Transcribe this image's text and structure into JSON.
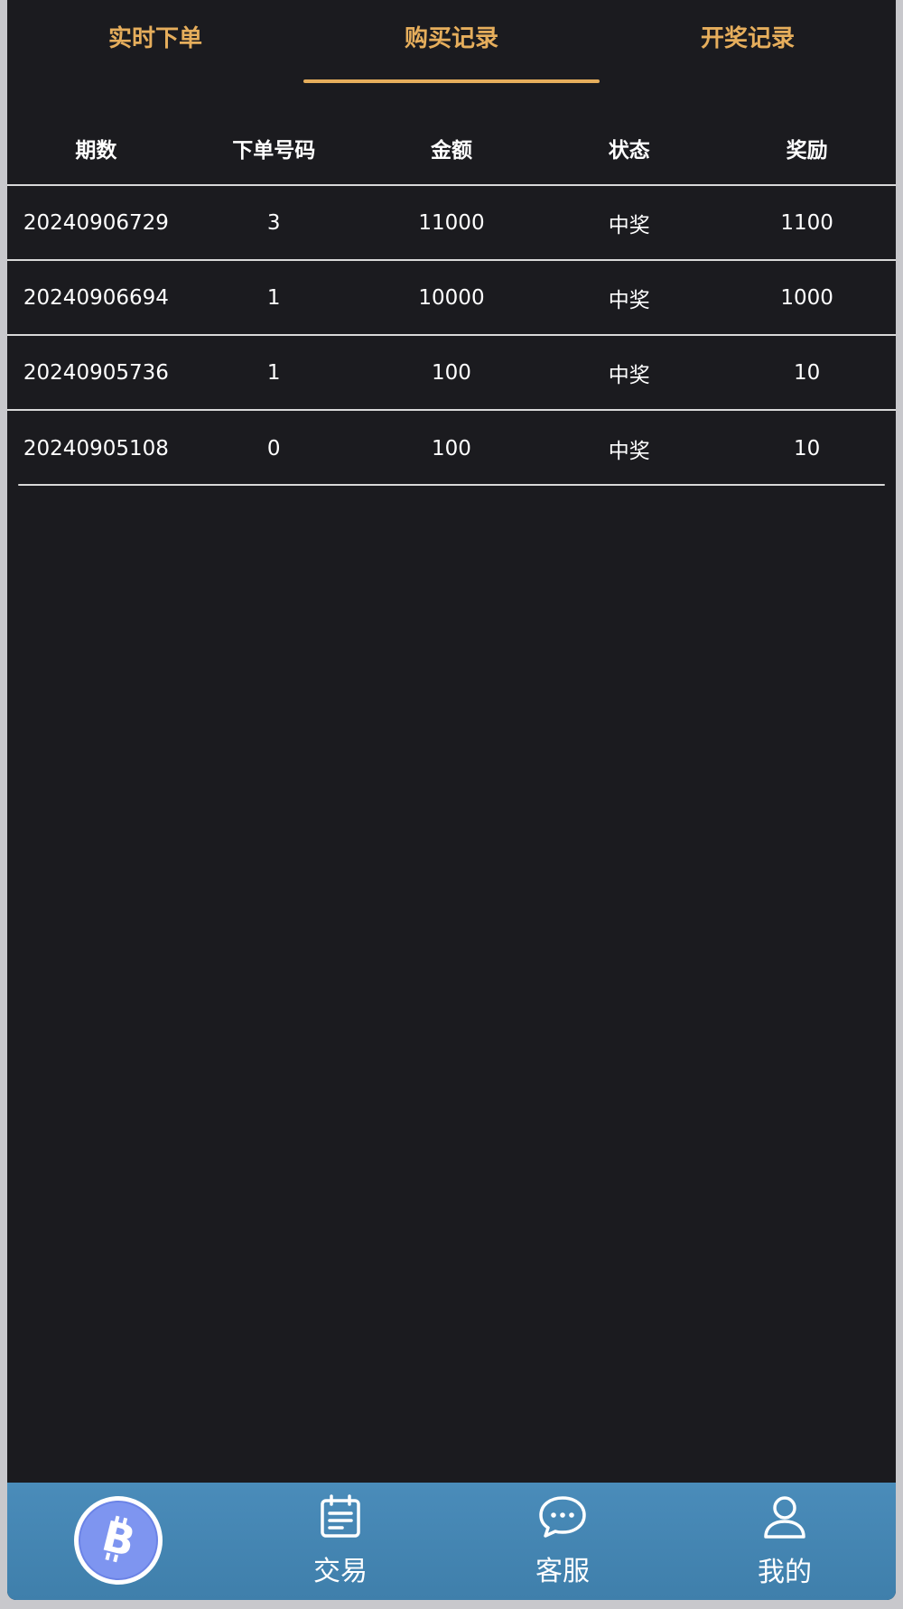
{
  "tabs": [
    {
      "label": "实时下单",
      "active": false
    },
    {
      "label": "购买记录",
      "active": true
    },
    {
      "label": "开奖记录",
      "active": false
    }
  ],
  "table": {
    "headers": [
      "期数",
      "下单号码",
      "金额",
      "状态",
      "奖励"
    ],
    "rows": [
      [
        "20240906729",
        "3",
        "11000",
        "中奖",
        "1100"
      ],
      [
        "20240906694",
        "1",
        "10000",
        "中奖",
        "1000"
      ],
      [
        "20240905736",
        "1",
        "100",
        "中奖",
        "10"
      ],
      [
        "20240905108",
        "0",
        "100",
        "中奖",
        "10"
      ]
    ]
  },
  "bottom_nav": {
    "items": [
      {
        "icon": "bitcoin-icon",
        "label": ""
      },
      {
        "icon": "notepad-icon",
        "label": "交易"
      },
      {
        "icon": "chat-bubble-icon",
        "label": "客服"
      },
      {
        "icon": "user-icon",
        "label": "我的"
      }
    ]
  },
  "colors": {
    "background": "#1b1b1f",
    "accent": "#e6ae5c",
    "nav_bar": "#4a8cba",
    "bitcoin": "#7e95f0"
  }
}
